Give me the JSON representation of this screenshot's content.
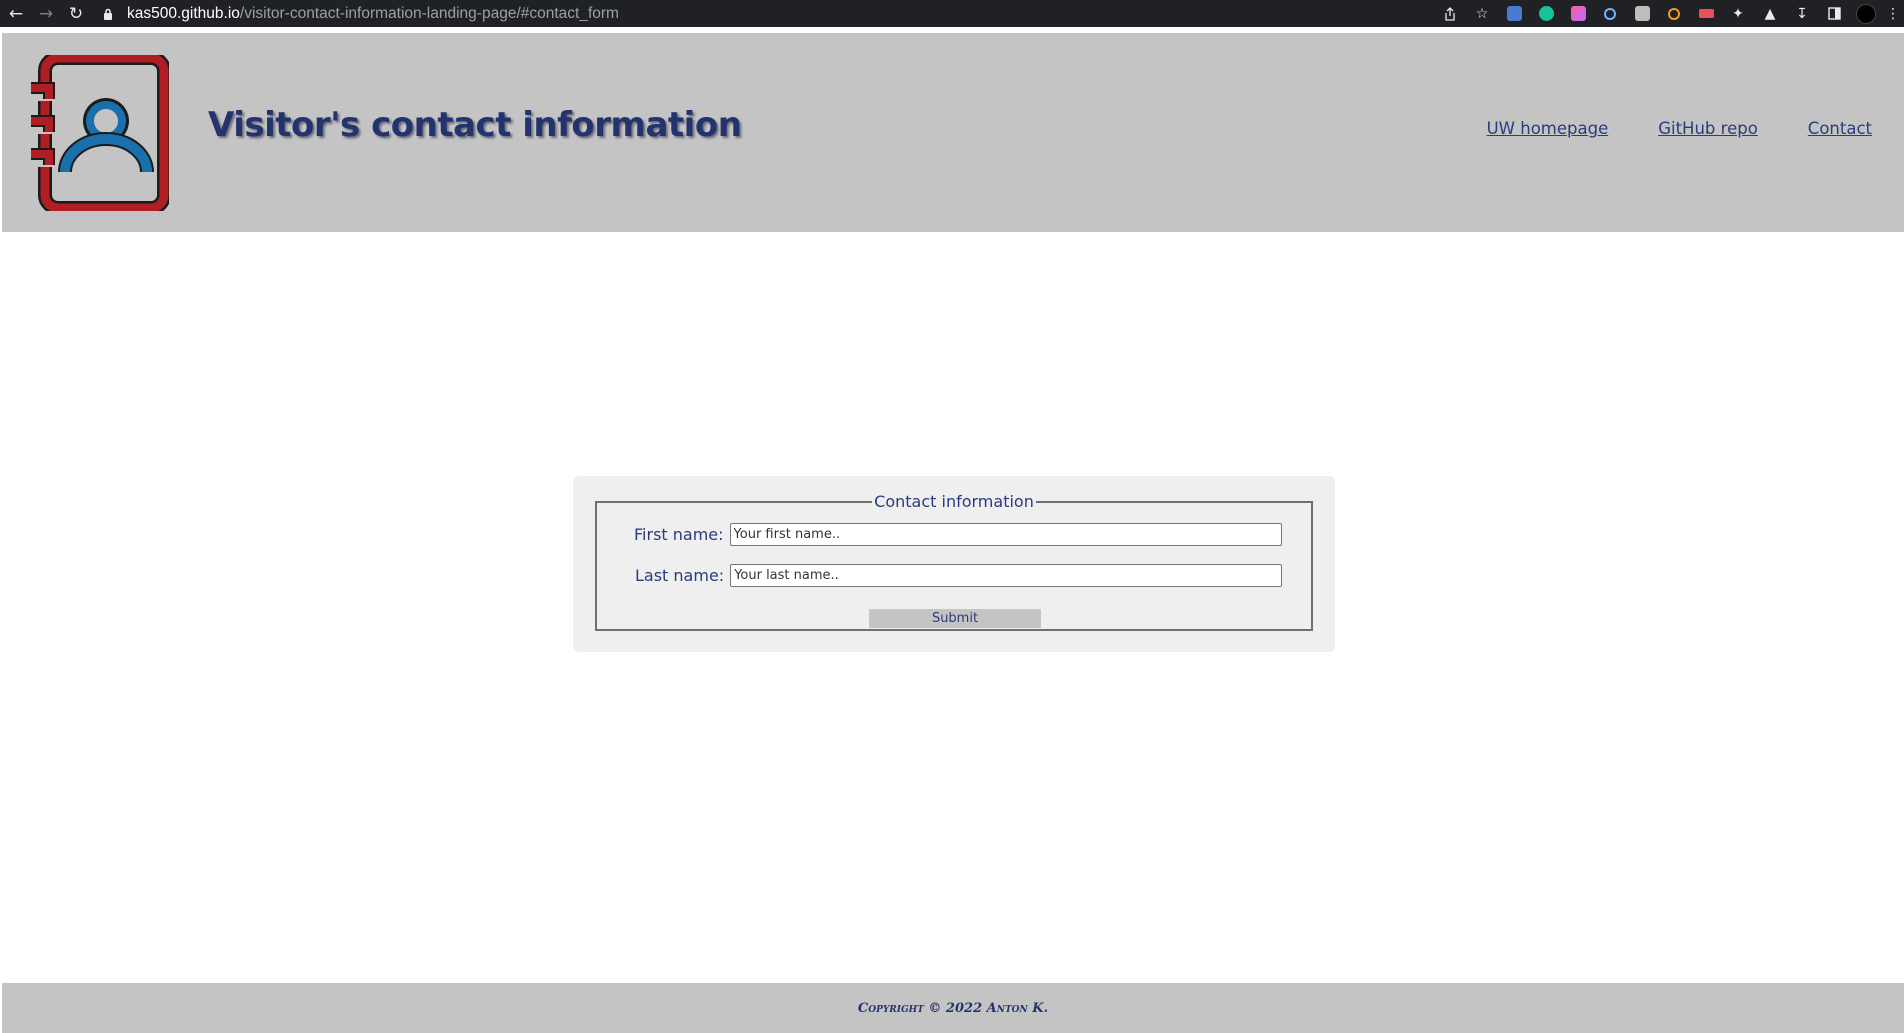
{
  "browser": {
    "url_host": "kas500.github.io",
    "url_path": "/visitor-contact-information-landing-page/#contact_form"
  },
  "header": {
    "title": "Visitor's contact information",
    "nav": [
      {
        "label": "UW homepage"
      },
      {
        "label": "GitHub repo"
      },
      {
        "label": "Contact"
      }
    ]
  },
  "form": {
    "legend": "Contact information",
    "first_name_label": "First name:",
    "first_name_placeholder": "Your first name..",
    "last_name_label": "Last name:",
    "last_name_placeholder": "Your last name..",
    "submit_label": "Submit"
  },
  "footer": {
    "copyright": "Copyright © 2022 Anton K."
  },
  "colors": {
    "header_bg": "#c4c4c4",
    "text_navy": "#23336d",
    "logo_red": "#b01e23",
    "logo_blue": "#1a6fad"
  }
}
